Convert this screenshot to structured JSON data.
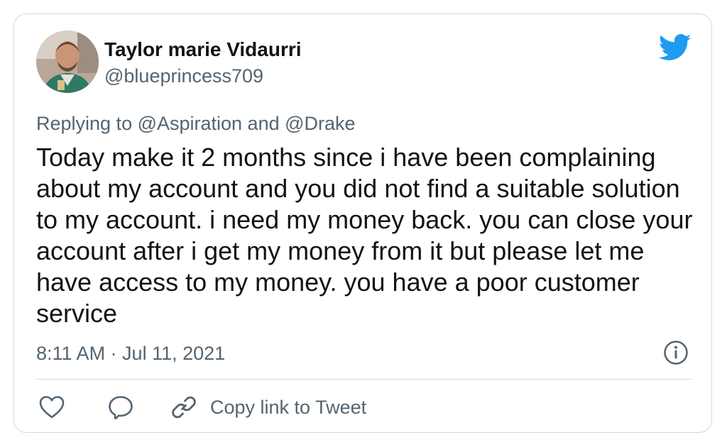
{
  "author": {
    "name": "Taylor marie Vidaurri",
    "handle": "@blueprincess709",
    "avatar_icon": "profile-photo"
  },
  "brand": {
    "icon": "twitter-bird-icon",
    "color": "#1d9bf0"
  },
  "reply_context": "Replying to @Aspiration and @Drake",
  "tweet": {
    "text": "Today make it 2 months since i have been complaining about my account and you did not find a suitable solution to my account. i need my money back. you can close your account after i get my money from it but please let me have access to my money. you have a poor customer service",
    "timestamp": "8:11 AM · Jul 11, 2021"
  },
  "actions": {
    "like_icon": "heart-icon",
    "reply_icon": "speech-bubble-icon",
    "copy_link_icon": "link-icon",
    "copy_link_label": "Copy link to Tweet",
    "info_icon": "info-icon"
  },
  "colors": {
    "text_primary": "#0f1419",
    "text_secondary": "#536471",
    "border": "#cfd9de"
  }
}
